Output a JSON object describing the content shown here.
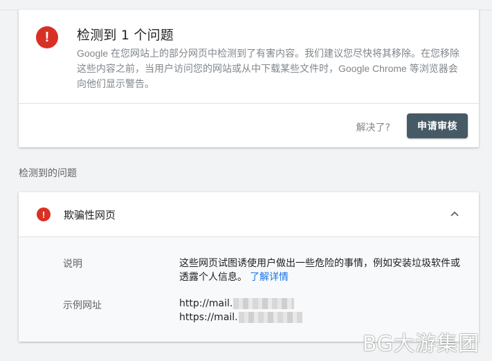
{
  "summary": {
    "title": "检测到 1 个问题",
    "description": "Google 在您网站上的部分网页中检测到了有害内容。我们建议您尽快将其移除。在您移除这些内容之前，当用户访问您的网站或从中下载某些文件时，Google Chrome 等浏览器会向他们显示警告。",
    "resolved_link": "解决了?",
    "request_review_button": "申请审核",
    "alert_glyph": "!"
  },
  "section": {
    "heading": "检测到的问题"
  },
  "issue": {
    "title": "欺骗性网页",
    "alert_glyph": "!",
    "expanded": true,
    "description_label": "说明",
    "description_text": "这些网页试图诱使用户做出一些危险的事情，例如安装垃圾软件或透露个人信息。",
    "learn_more_link": "了解详情",
    "sample_urls_label": "示例网址",
    "sample_urls": [
      "http://mail.",
      "https://mail."
    ]
  },
  "watermark": "BG大游集团",
  "colors": {
    "alert_red": "#d93025",
    "primary_button": "#455a64",
    "link_blue": "#1a73e8",
    "muted_text": "#80868b"
  },
  "icons": {
    "alert": "alert-circle-icon",
    "collapse": "chevron-up-icon"
  }
}
